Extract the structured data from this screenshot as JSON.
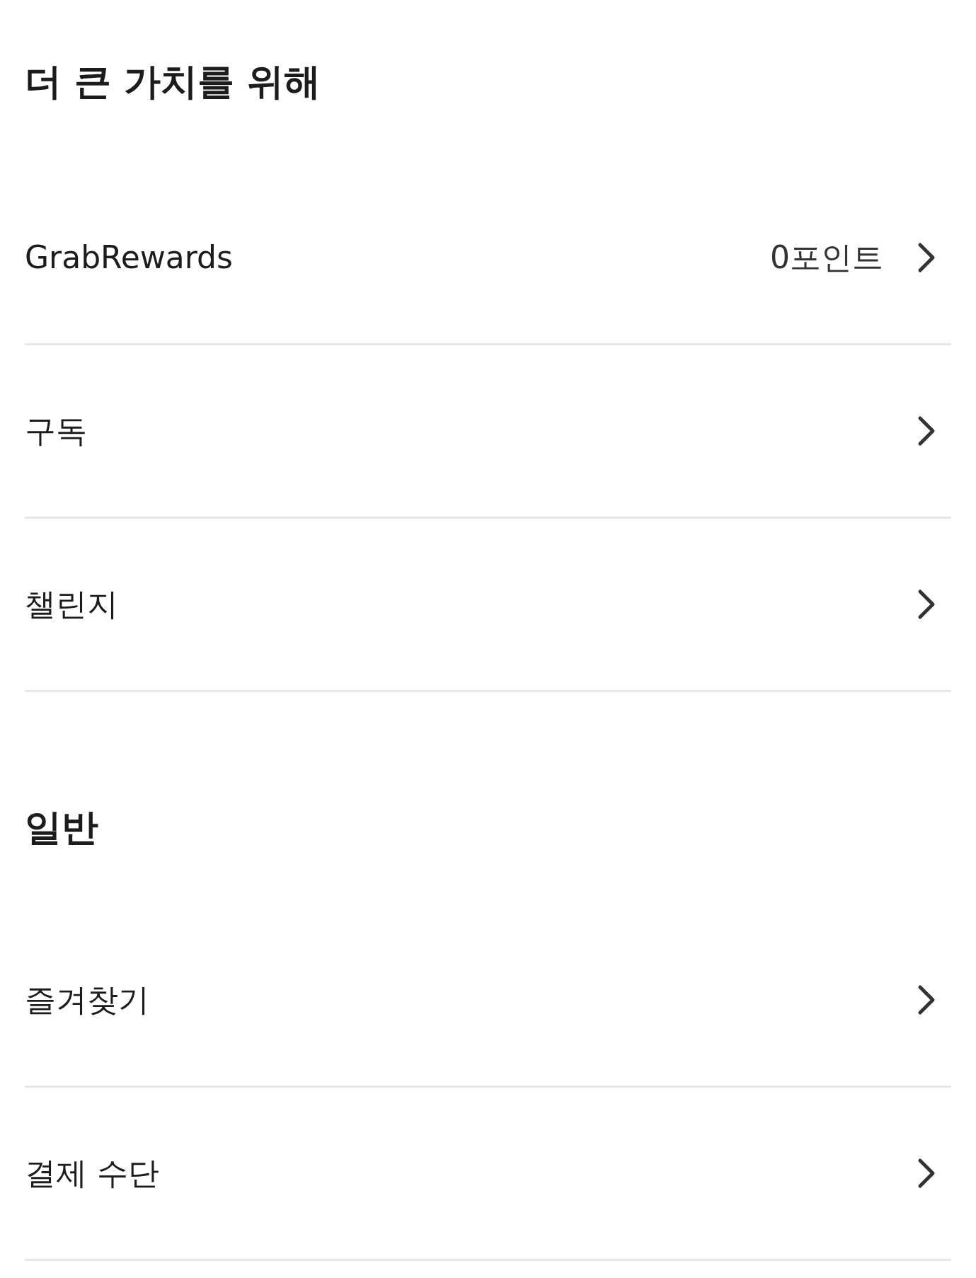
{
  "sections": [
    {
      "title": "더 큰 가치를 위해",
      "items": [
        {
          "label": "GrabRewards",
          "value": "0포인트"
        },
        {
          "label": "구독"
        },
        {
          "label": "챌린지"
        }
      ]
    },
    {
      "title": "일반",
      "items": [
        {
          "label": "즐겨찾기"
        },
        {
          "label": "결제 수단"
        }
      ]
    }
  ]
}
